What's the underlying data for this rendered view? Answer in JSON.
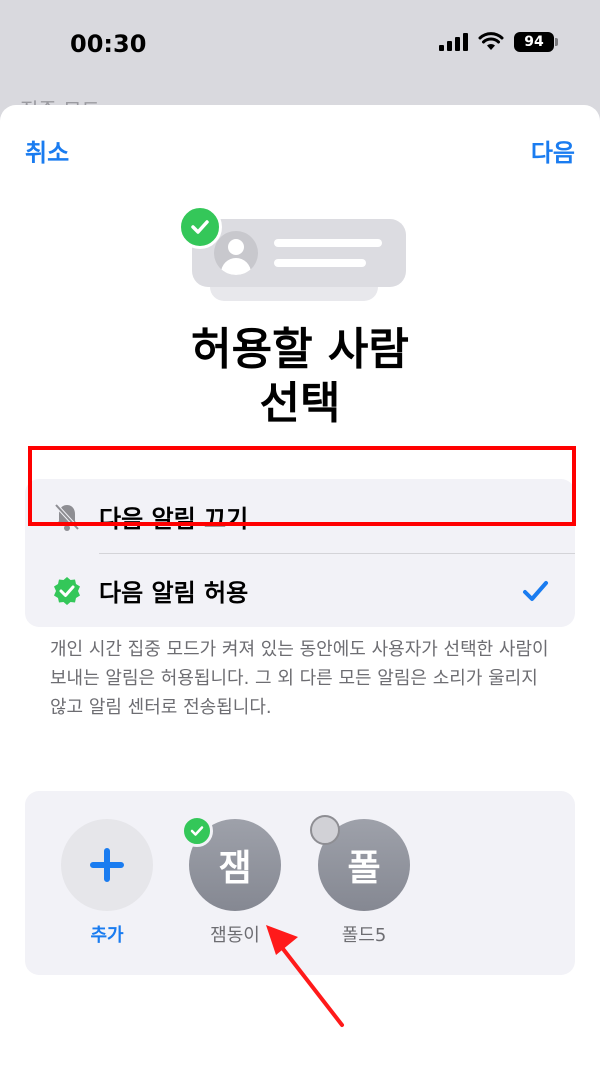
{
  "status_bar": {
    "time": "00:30",
    "battery": "94"
  },
  "background": {
    "back_hint": "집중 모드"
  },
  "nav": {
    "cancel_label": "취소",
    "next_label": "다음"
  },
  "title": {
    "line1": "허용할 사람",
    "line2": "선택"
  },
  "options": [
    {
      "label": "다음 알림 끄기",
      "icon": "bell-slash-icon",
      "selected": false
    },
    {
      "label": "다음 알림 허용",
      "icon": "checkmark-seal-icon",
      "selected": true
    }
  ],
  "description": "개인 시간 집중 모드가 켜져 있는 동안에도 사용자가 선택한 사람이 보내는 알림은 허용됩니다. 그 외 다른 모든 알림은 소리가 울리지 않고 알림 센터로 전송됩니다.",
  "people": [
    {
      "name": "추가",
      "initial": "+",
      "type": "add"
    },
    {
      "name": "잼동이",
      "initial": "잼",
      "selected": true
    },
    {
      "name": "폴드5",
      "initial": "폴",
      "selected": false
    }
  ],
  "colors": {
    "accent": "#1a7cf0",
    "success": "#34c759",
    "annotation": "#ff0000"
  }
}
